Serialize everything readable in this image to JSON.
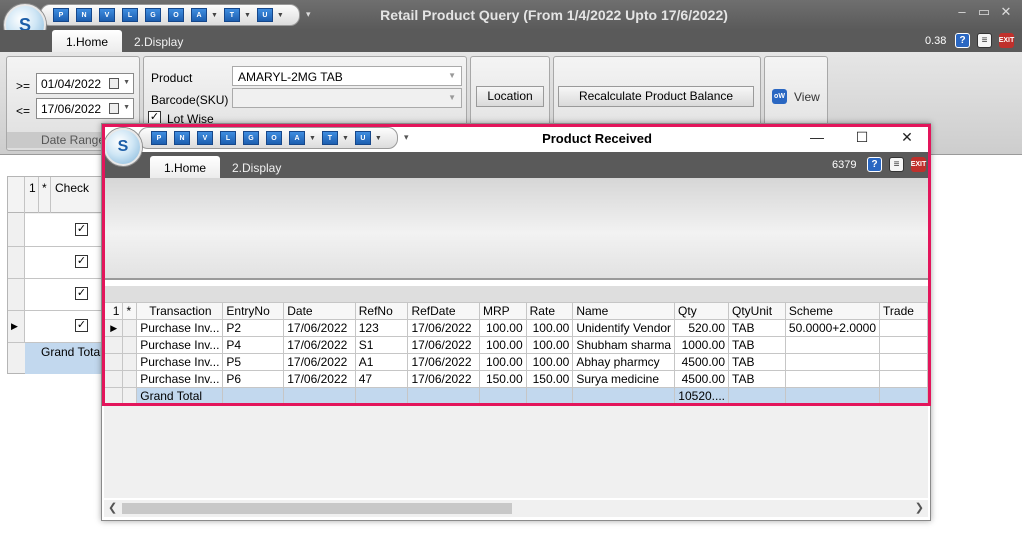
{
  "app": {
    "title": "Retail Product Query (From 1/4/2022 Upto 17/6/2022)",
    "tabs": [
      "1.Home",
      "2.Display"
    ],
    "zoom": "0.38",
    "logo_text": "S"
  },
  "quick_access": [
    "P",
    "N",
    "V",
    "L",
    "G",
    "O",
    "A",
    "T",
    "U"
  ],
  "ribbon": {
    "date_from_label": ">=",
    "date_from": "01/04/2022",
    "date_to_label": "<=",
    "date_to": "17/06/2022",
    "date_group_label": "Date Range",
    "product_label": "Product",
    "product_value": "AMARYL-2MG TAB",
    "barcode_label": "Barcode(SKU)",
    "barcode_value": "",
    "lot_wise_label": "Lot Wise",
    "location_button": "Location",
    "recalc_button": "Recalculate Product Balance",
    "view_button": "View"
  },
  "main_grid": {
    "col_num": "1",
    "col_star": "*",
    "col_check": "Check",
    "grand_total": "Grand Total"
  },
  "dialog": {
    "title": "Product Received",
    "tabs": [
      "1.Home",
      "2.Display"
    ],
    "count": "6379",
    "columns": [
      "1",
      "*",
      "Transaction",
      "EntryNo",
      "Date",
      "RefNo",
      "RefDate",
      "MRP",
      "Rate",
      "Name",
      "Qty",
      "QtyUnit",
      "Scheme",
      "Trade"
    ],
    "rows": [
      {
        "transaction": "Purchase Inv...",
        "entry_no": "P2",
        "date": "17/06/2022",
        "ref_no": "123",
        "ref_date": "17/06/2022",
        "mrp": "100.00",
        "rate": "100.00",
        "name": "Unidentify Vendor",
        "qty": "520.00",
        "qty_unit": "TAB",
        "scheme": "50.0000+2.0000",
        "trade": ""
      },
      {
        "transaction": "Purchase Inv...",
        "entry_no": "P4",
        "date": "17/06/2022",
        "ref_no": "S1",
        "ref_date": "17/06/2022",
        "mrp": "100.00",
        "rate": "100.00",
        "name": "Shubham sharma",
        "qty": "1000.00",
        "qty_unit": "TAB",
        "scheme": "",
        "trade": ""
      },
      {
        "transaction": "Purchase Inv...",
        "entry_no": "P5",
        "date": "17/06/2022",
        "ref_no": "A1",
        "ref_date": "17/06/2022",
        "mrp": "100.00",
        "rate": "100.00",
        "name": "Abhay pharmcy",
        "qty": "4500.00",
        "qty_unit": "TAB",
        "scheme": "",
        "trade": ""
      },
      {
        "transaction": "Purchase Inv...",
        "entry_no": "P6",
        "date": "17/06/2022",
        "ref_no": "47",
        "ref_date": "17/06/2022",
        "mrp": "150.00",
        "rate": "150.00",
        "name": "Surya medicine",
        "qty": "4500.00",
        "qty_unit": "TAB",
        "scheme": "",
        "trade": ""
      }
    ],
    "grand_total_label": "Grand Total",
    "grand_total_qty": "10520...."
  },
  "colors": {
    "title_bar": "#5a5a5a",
    "highlight": "#e3155b",
    "total_row": "#c2d8ee",
    "icon_blue": "#2a67c2"
  }
}
